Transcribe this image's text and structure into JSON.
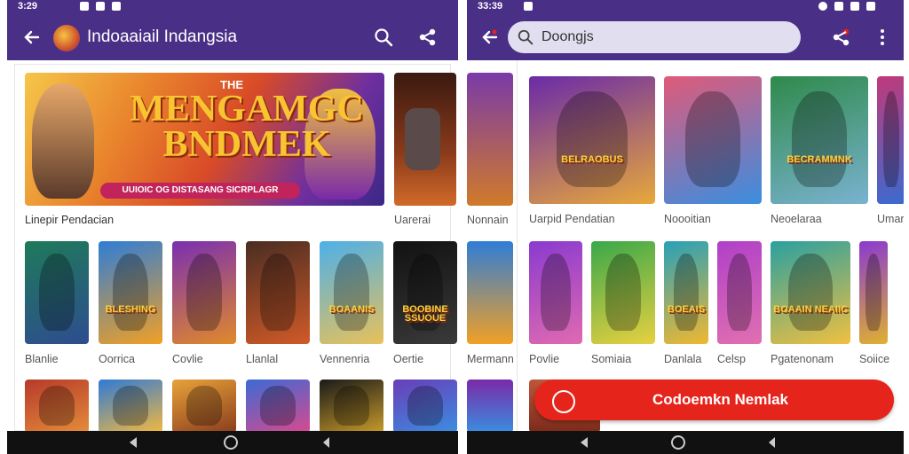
{
  "left": {
    "status_time": "3:29",
    "app_title": "Indoaaiail Indangsia",
    "banner": {
      "title": "MENGAMGC BNDMEK",
      "ribbon": "UUIOIC OG DISTASANG SICRPLAGR",
      "subtitle": "THE"
    },
    "banner_caption": "Linepir Pendacian",
    "side_caption": "Uarerai",
    "row1": [
      {
        "label": "Blanlie",
        "colors": [
          "#1e7a5a",
          "#2e4d8f"
        ]
      },
      {
        "label": "Oorrica",
        "colors": [
          "#2f7dd6",
          "#f0a025"
        ]
      },
      {
        "label": "Covlie",
        "colors": [
          "#7a2fb0",
          "#e0892a"
        ]
      },
      {
        "label": "Llanlal",
        "colors": [
          "#4a2d22",
          "#d05a28"
        ]
      },
      {
        "label": "Vennenria",
        "colors": [
          "#4db0e8",
          "#e8c15a"
        ]
      },
      {
        "label": "Oertie",
        "colors": [
          "#111111",
          "#3a3a3a"
        ]
      }
    ],
    "row1_overlays": [
      "",
      "BLESHING",
      "",
      "",
      "BOAANIS",
      "BOOBINE SSUOUE"
    ],
    "row2_colors": [
      [
        "#b63a2a",
        "#e58c3a"
      ],
      [
        "#2f7ad6",
        "#f3b840"
      ],
      [
        "#e8a23a",
        "#8a3d1d"
      ],
      [
        "#3c6ad4",
        "#d84a8e"
      ],
      [
        "#1a1a1a",
        "#c79a2a"
      ],
      [
        "#6a3db8",
        "#3a8ee0"
      ]
    ]
  },
  "right": {
    "status_time": "33:39",
    "search_placeholder": "Doongjs",
    "side_caption": "Nonnain",
    "side_caption2": "Mermann",
    "row1": [
      {
        "label": "Uarpid Pendatian",
        "overlay": "BELRAOBUS",
        "colors": [
          "#6a2aa8",
          "#e8a83a"
        ]
      },
      {
        "label": "Noooitian",
        "overlay": "",
        "colors": [
          "#e05a7a",
          "#3a8ee0"
        ]
      },
      {
        "label": "Neoelaraa",
        "overlay": "BECRAMMNK",
        "colors": [
          "#2e8a4a",
          "#7ab2d0"
        ]
      },
      {
        "label": "Umar",
        "overlay": "",
        "colors": [
          "#c03a7a",
          "#3a6ad0"
        ]
      }
    ],
    "row2": [
      {
        "label": "Povlie",
        "colors": [
          "#8a3ad0",
          "#e06ab0"
        ]
      },
      {
        "label": "Somiaia",
        "colors": [
          "#3aa84a",
          "#e8d040"
        ]
      },
      {
        "label": "Danlala",
        "colors": [
          "#28a0b8",
          "#f0b830"
        ]
      },
      {
        "label": "Celsp",
        "colors": [
          "#b040c8",
          "#e070b0"
        ]
      },
      {
        "label": "Pgatenonam",
        "colors": [
          "#2aa0a0",
          "#f0c040"
        ]
      },
      {
        "label": "Soiice",
        "colors": [
          "#8a3ad0",
          "#e0b030"
        ]
      }
    ],
    "row2_overlays": [
      "",
      "",
      "BOEAIS",
      "",
      "BOAAIN NEAIIC",
      ""
    ],
    "row3_colors": [
      [
        "#c0563a",
        "#7a2a1a"
      ]
    ],
    "cta_label": "Codoemkn Nemlak"
  }
}
